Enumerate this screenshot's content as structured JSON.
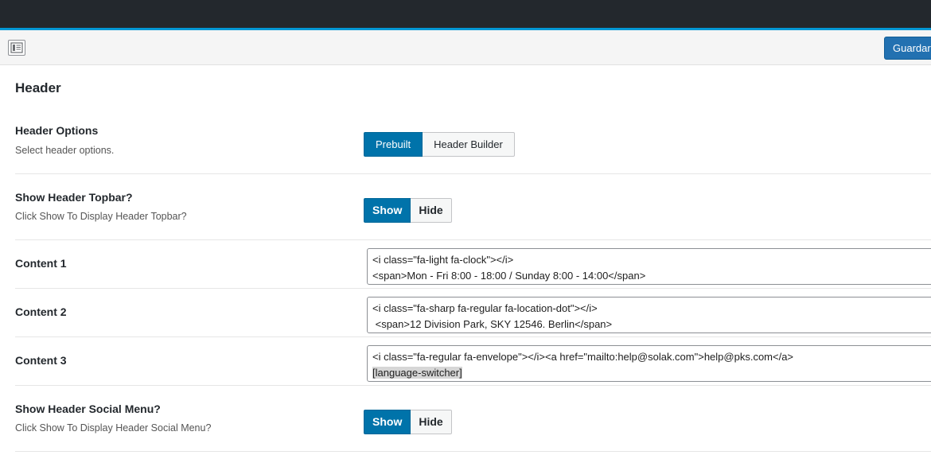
{
  "toolbar": {
    "layout_icon": "layout-icon",
    "save_label": "Guardar"
  },
  "section": {
    "title": "Header"
  },
  "rows": {
    "header_options": {
      "label": "Header Options",
      "desc": "Select header options.",
      "options": [
        "Prebuilt",
        "Header Builder"
      ],
      "selected": "Prebuilt"
    },
    "topbar": {
      "label": "Show Header Topbar?",
      "desc": "Click Show To Display Header Topbar?",
      "options": [
        "Show",
        "Hide"
      ],
      "selected": "Show"
    },
    "content1": {
      "label": "Content 1",
      "line1": "<i class=\"fa-light fa-clock\"></i>",
      "line2": "<span>Mon - Fri 8:00 - 18:00 / Sunday 8:00 - 14:00</span>"
    },
    "content2": {
      "label": "Content 2",
      "line1": "<i class=\"fa-sharp fa-regular fa-location-dot\"></i>",
      "line2": " <span>12 Division Park, SKY 12546. Berlin</span>"
    },
    "content3": {
      "label": "Content 3",
      "line1": "<i class=\"fa-regular fa-envelope\"></i><a href=\"mailto:help@solak.com\">help@pks.com</a>",
      "line2": "[language-switcher]"
    },
    "social": {
      "label": "Show Header Social Menu?",
      "desc": "Click Show To Display Header Social Menu?",
      "options": [
        "Show",
        "Hide"
      ],
      "selected": "Show"
    }
  },
  "colors": {
    "adminbar": "#23282d",
    "accent": "#0098d4",
    "primary": "#0073aa",
    "save": "#2271b1"
  }
}
